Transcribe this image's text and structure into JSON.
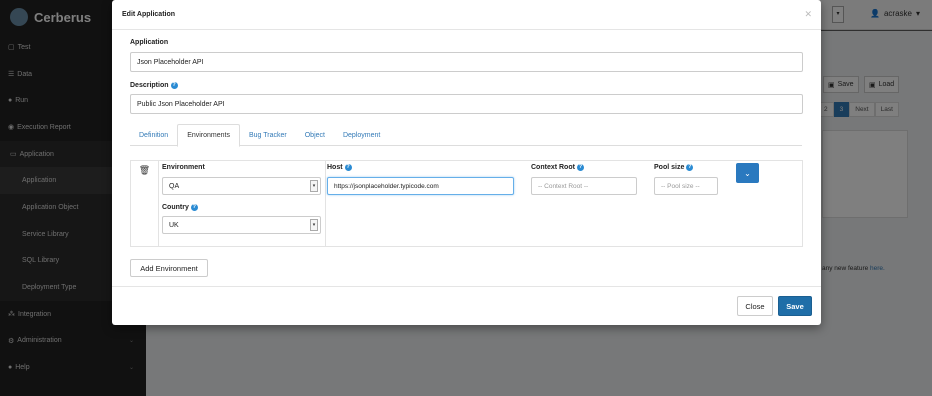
{
  "app": {
    "name": "Cerberus"
  },
  "sidebar": {
    "items": [
      {
        "label": "Test",
        "icon": "document-icon"
      },
      {
        "label": "Data",
        "icon": "database-icon"
      },
      {
        "label": "Run",
        "icon": "play-icon"
      },
      {
        "label": "Execution Report",
        "icon": "chart-icon"
      },
      {
        "label": "Application",
        "icon": "desktop-icon"
      },
      {
        "label": "Application"
      },
      {
        "label": "Application Object"
      },
      {
        "label": "Service Library"
      },
      {
        "label": "SQL Library"
      },
      {
        "label": "Deployment Type"
      },
      {
        "label": "Integration",
        "icon": "sitemap-icon"
      },
      {
        "label": "Administration",
        "icon": "gears-icon"
      },
      {
        "label": "Help",
        "icon": "help-icon"
      }
    ]
  },
  "topbar": {
    "user": "acraske"
  },
  "background": {
    "save_label": "Save",
    "load_label": "Load",
    "pager": [
      "2",
      "3",
      "Next",
      "Last"
    ],
    "note_text": "r any new feature ",
    "note_link": "here."
  },
  "modal": {
    "title": "Edit Application",
    "application_label": "Application",
    "application_value": "Json Placeholder API",
    "description_label": "Description",
    "description_value": "Public Json Placeholder API",
    "tabs": [
      "Definition",
      "Environments",
      "Bug Tracker",
      "Object",
      "Deployment"
    ],
    "active_tab": "Environments",
    "env": {
      "environment_label": "Environment",
      "environment_value": "QA",
      "host_label": "Host",
      "host_value": "https://jsonplaceholder.typicode.com",
      "context_root_label": "Context Root",
      "context_root_placeholder": "-- Context Root --",
      "pool_size_label": "Pool size",
      "pool_size_placeholder": "-- Pool size --",
      "country_label": "Country",
      "country_value": "UK"
    },
    "add_environment_label": "Add Environment",
    "close_label": "Close",
    "save_label": "Save"
  },
  "colors": {
    "primary": "#1f6ea8",
    "link": "#337ab7",
    "sidebar": "#222222"
  }
}
